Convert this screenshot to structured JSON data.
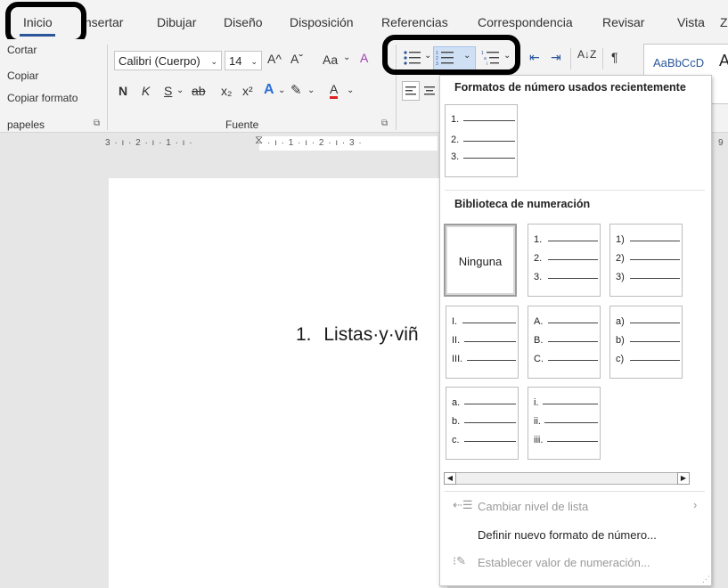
{
  "tabs": [
    {
      "label": "Inicio"
    },
    {
      "label": "Insertar"
    },
    {
      "label": "Dibujar"
    },
    {
      "label": "Diseño"
    },
    {
      "label": "Disposición"
    },
    {
      "label": "Referencias"
    },
    {
      "label": "Correspondencia"
    },
    {
      "label": "Revisar"
    },
    {
      "label": "Vista"
    },
    {
      "label": "Z"
    }
  ],
  "clipboard": {
    "cut": "Cortar",
    "copy": "Copiar",
    "format_painter": "Copiar formato",
    "group_label": "papeles"
  },
  "font": {
    "name": "Calibri (Cuerpo)",
    "size": "14",
    "grow": "A^",
    "shrink": "Aˇ",
    "case": "Aa",
    "bold": "N",
    "italic": "K",
    "underline": "S",
    "strike": "ab",
    "subscript": "x₂",
    "superscript": "x²",
    "group_label": "Fuente"
  },
  "paragraph": {
    "sort": "A↓Z",
    "pilcrow": "¶"
  },
  "styles": {
    "preview": "AaBbCcD",
    "preview2": "A"
  },
  "ruler": {
    "left_text": "3 · ı · 2 · ı · 1 · ı ·",
    "right_text": "· ı · 1 · ı · 2 · ı · 3 ·",
    "far_right": "9"
  },
  "document": {
    "line_number": "1.",
    "line_text": "Listas·y·viñ"
  },
  "numbering_menu": {
    "recent_header": "Formatos de número usados recientemente",
    "library_header": "Biblioteca de numeración",
    "none_label": "Ninguna",
    "recent": [
      [
        "1.",
        "2.",
        "3."
      ]
    ],
    "library": [
      [
        "1.",
        "2.",
        "3."
      ],
      [
        "1)",
        "2)",
        "3)"
      ],
      [
        "I.",
        "II.",
        "III."
      ],
      [
        "A.",
        "B.",
        "C."
      ],
      [
        "a)",
        "b)",
        "c)"
      ],
      [
        "a.",
        "b.",
        "c."
      ],
      [
        "i.",
        "ii.",
        "iii."
      ]
    ],
    "change_level": "Cambiar nivel de lista",
    "define_new": "Definir nuevo formato de número...",
    "set_value": "Establecer valor de numeración..."
  },
  "colors": {
    "accent": "#2b579a",
    "highlight_border": "#000000",
    "font_color_underline": "#e02020"
  }
}
